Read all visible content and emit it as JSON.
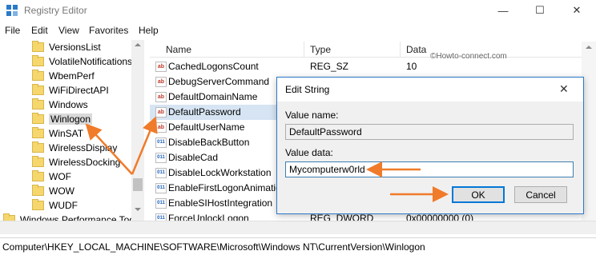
{
  "window": {
    "title": "Registry Editor",
    "minimize_glyph": "—",
    "maximize_glyph": "☐",
    "close_glyph": "✕"
  },
  "menu": [
    "File",
    "Edit",
    "View",
    "Favorites",
    "Help"
  ],
  "tree": {
    "items": [
      {
        "label": "VersionsList",
        "selected": false
      },
      {
        "label": "VolatileNotifications",
        "selected": false
      },
      {
        "label": "WbemPerf",
        "selected": false
      },
      {
        "label": "WiFiDirectAPI",
        "selected": false
      },
      {
        "label": "Windows",
        "selected": false
      },
      {
        "label": "Winlogon",
        "selected": true
      },
      {
        "label": "WinSAT",
        "selected": false
      },
      {
        "label": "WirelessDisplay",
        "selected": false
      },
      {
        "label": "WirelessDocking",
        "selected": false
      },
      {
        "label": "WOF",
        "selected": false
      },
      {
        "label": "WOW",
        "selected": false
      },
      {
        "label": "WUDF",
        "selected": false
      },
      {
        "label": "Windows Performance Too",
        "selected": false
      }
    ]
  },
  "list": {
    "columns": [
      "Name",
      "Type",
      "Data"
    ],
    "watermark": "©Howto-connect.com",
    "rows": [
      {
        "icon": "ab",
        "name": "CachedLogonsCount",
        "type": "REG_SZ",
        "data": "10"
      },
      {
        "icon": "ab",
        "name": "DebugServerCommand",
        "type": "",
        "data": ""
      },
      {
        "icon": "ab",
        "name": "DefaultDomainName",
        "type": "",
        "data": ""
      },
      {
        "icon": "ab",
        "name": "DefaultPassword",
        "type": "",
        "data": "",
        "selected": true
      },
      {
        "icon": "ab",
        "name": "DefaultUserName",
        "type": "",
        "data": ""
      },
      {
        "icon": "011",
        "name": "DisableBackButton",
        "type": "",
        "data": ""
      },
      {
        "icon": "011",
        "name": "DisableCad",
        "type": "",
        "data": ""
      },
      {
        "icon": "011",
        "name": "DisableLockWorkstation",
        "type": "",
        "data": ""
      },
      {
        "icon": "011",
        "name": "EnableFirstLogonAnimatio",
        "type": "",
        "data": ""
      },
      {
        "icon": "011",
        "name": "EnableSIHostIntegration",
        "type": "",
        "data": ""
      },
      {
        "icon": "011",
        "name": "ForceUnlockLogon",
        "type": "REG_DWORD",
        "data": "0x00000000 (0)"
      }
    ]
  },
  "dialog": {
    "title": "Edit String",
    "close_glyph": "✕",
    "value_name_label": "Value name:",
    "value_name": "DefaultPassword",
    "value_data_label": "Value data:",
    "value_data": "Mycomputerw0rld",
    "ok_label": "OK",
    "cancel_label": "Cancel"
  },
  "status": {
    "path": "Computer\\HKEY_LOCAL_MACHINE\\SOFTWARE\\Microsoft\\Windows NT\\CurrentVersion\\Winlogon"
  },
  "colors": {
    "annotation_arrow": "#f07b2a",
    "dialog_border": "#2a7ac8",
    "selection": "#d6e4f3"
  }
}
